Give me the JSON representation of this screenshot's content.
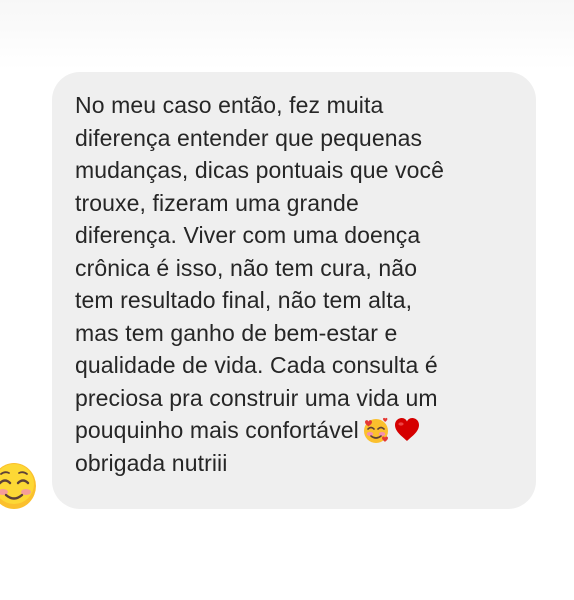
{
  "message": {
    "sender_avatar_icon": "smiling-face-emoji-icon",
    "text": "No meu caso então, fez muita\ndiferença entender que pequenas\nmudanças, dicas pontuais que você\ntrouxe, fizeram uma grande\ndiferença. Viver com uma doença\ncrônica é isso, não tem cura, não\ntem resultado final, não tem alta,\nmas tem ganho de bem-estar e\nqualidade de vida. Cada consulta é\npreciosa pra construir uma vida um\npouquinho mais confortável",
    "trailing_emojis": [
      "smiling-face-with-hearts-emoji-icon",
      "red-heart-emoji-icon"
    ],
    "closing_text": "obrigada nutriii",
    "bubble_color": "#efefef",
    "text_color": "#262626"
  }
}
